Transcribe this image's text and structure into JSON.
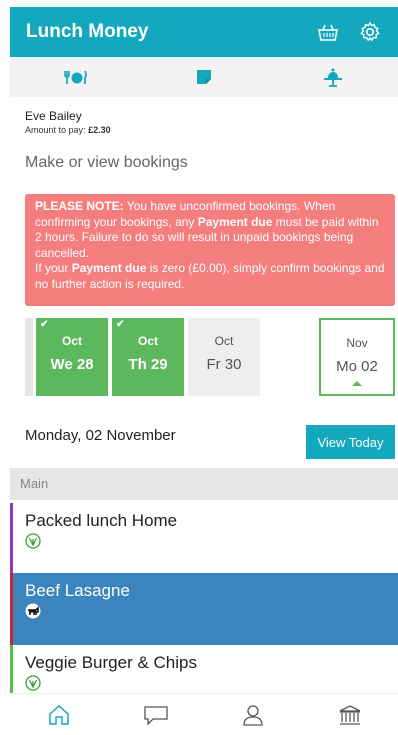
{
  "header": {
    "title": "Lunch Money",
    "basket_icon": "basket-icon",
    "settings_icon": "gear-icon"
  },
  "subnav": {
    "items": [
      {
        "icon": "meal-icon"
      },
      {
        "icon": "note-icon"
      },
      {
        "icon": "tray-icon"
      }
    ]
  },
  "pupil": {
    "name": "Eve Bailey",
    "amount_label": "Amount to pay:",
    "amount": "£2.30"
  },
  "page_heading": "Make or view bookings",
  "notice": {
    "label": "PLEASE NOTE:",
    "text1": " You have unconfirmed bookings. When confirming your bookings, any ",
    "payment_due": "Payment due",
    "text2": " must be paid within 2 hours. Failure to do so will result in unpaid bookings being cancelled.",
    "text3": "If your ",
    "payment_due2": "Payment due",
    "text4": " is zero (£0.00), simply confirm bookings and no further action is required."
  },
  "dates": [
    {
      "month": "Oct",
      "day": "We 28",
      "state": "booked"
    },
    {
      "month": "Oct",
      "day": "Th 29",
      "state": "booked"
    },
    {
      "month": "Oct",
      "day": "Fr 30",
      "state": "unavailable"
    },
    {
      "month": "Nov",
      "day": "Mo 02",
      "state": "selected"
    }
  ],
  "selected_day": "Monday, 02 November",
  "view_today": "View Today",
  "section_label": "Main",
  "meals": [
    {
      "name": "Packed lunch Home",
      "icon": "vegetarian-icon",
      "accent": "#9b30c8"
    },
    {
      "name": "Beef Lasagne",
      "icon": "beef-icon",
      "accent": "#c4262e"
    },
    {
      "name": "Veggie Burger & Chips",
      "icon": "vegetarian-icon",
      "accent": "#55c244"
    }
  ],
  "bottom_nav": [
    {
      "icon": "home-icon"
    },
    {
      "icon": "chat-icon"
    },
    {
      "icon": "user-icon"
    },
    {
      "icon": "bank-icon"
    }
  ],
  "colors": {
    "brand": "#13a8bd",
    "booked": "#5cb85c",
    "notice": "#f47e7e",
    "selected_meal": "#3c84bd"
  }
}
